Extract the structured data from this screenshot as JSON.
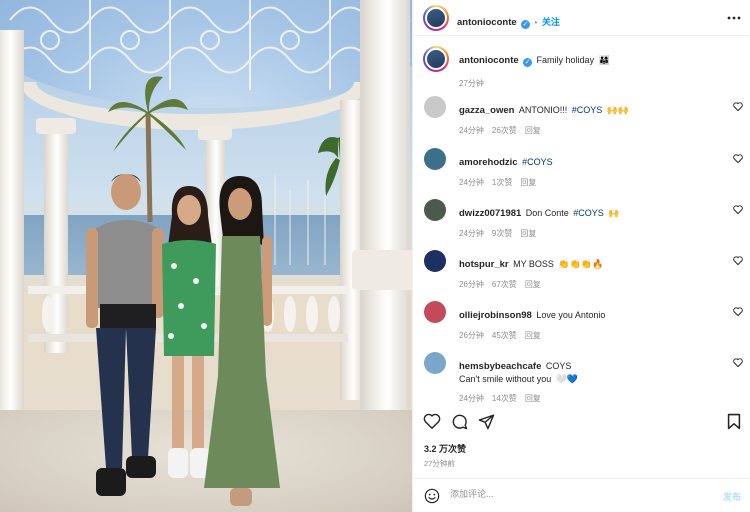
{
  "header": {
    "username": "antonioconte",
    "follow_label": "关注",
    "more_icon": "more-dots-icon"
  },
  "caption": {
    "username": "antonioconte",
    "text": "Family holiday",
    "emoji": "👨‍👩‍👧",
    "time": "27分钟"
  },
  "comments": [
    {
      "username": "gazza_owen",
      "text": "ANTONIO!!!",
      "tag": "#COYS",
      "emoji": "🙌🙌",
      "time": "24分钟",
      "likes": "26次赞",
      "reply": "回复",
      "avatar_color": "#c9c9c9"
    },
    {
      "username": "amorehodzic",
      "text": "",
      "tag": "#COYS",
      "emoji": "",
      "time": "24分钟",
      "likes": "1次赞",
      "reply": "回复",
      "avatar_color": "#3d6e8a"
    },
    {
      "username": "dwizz0071981",
      "text": "Don Conte",
      "tag": "#COYS",
      "emoji": "🙌",
      "time": "24分钟",
      "likes": "9次赞",
      "reply": "回复",
      "avatar_color": "#4b5a4a"
    },
    {
      "username": "hotspur_kr",
      "text": "MY BOSS",
      "tag": "",
      "emoji": "👏👏👏🔥",
      "time": "26分钟",
      "likes": "67次赞",
      "reply": "回复",
      "avatar_color": "#1d2f63"
    },
    {
      "username": "olliejrobinson98",
      "text": "Love you Antonio",
      "tag": "",
      "emoji": "",
      "time": "26分钟",
      "likes": "45次赞",
      "reply": "回复",
      "avatar_color": "#c44a5a"
    },
    {
      "username": "hemsbybeachcafe",
      "text": "COYS",
      "tag": "",
      "emoji": "",
      "line2": "Can't smile without you",
      "line2_emoji": "🤍💙",
      "time": "24分钟",
      "likes": "14次赞",
      "reply": "回复",
      "avatar_color": "#7aa6c9"
    }
  ],
  "stats": {
    "likes": "3.2 万次赞",
    "posted": "27分钟前"
  },
  "add_comment": {
    "placeholder": "添加评论...",
    "post_label": "发布"
  },
  "colors": {
    "verified": "#3897f0",
    "link": "#00376b",
    "follow": "#0095f6",
    "muted": "#8e8e8e"
  }
}
